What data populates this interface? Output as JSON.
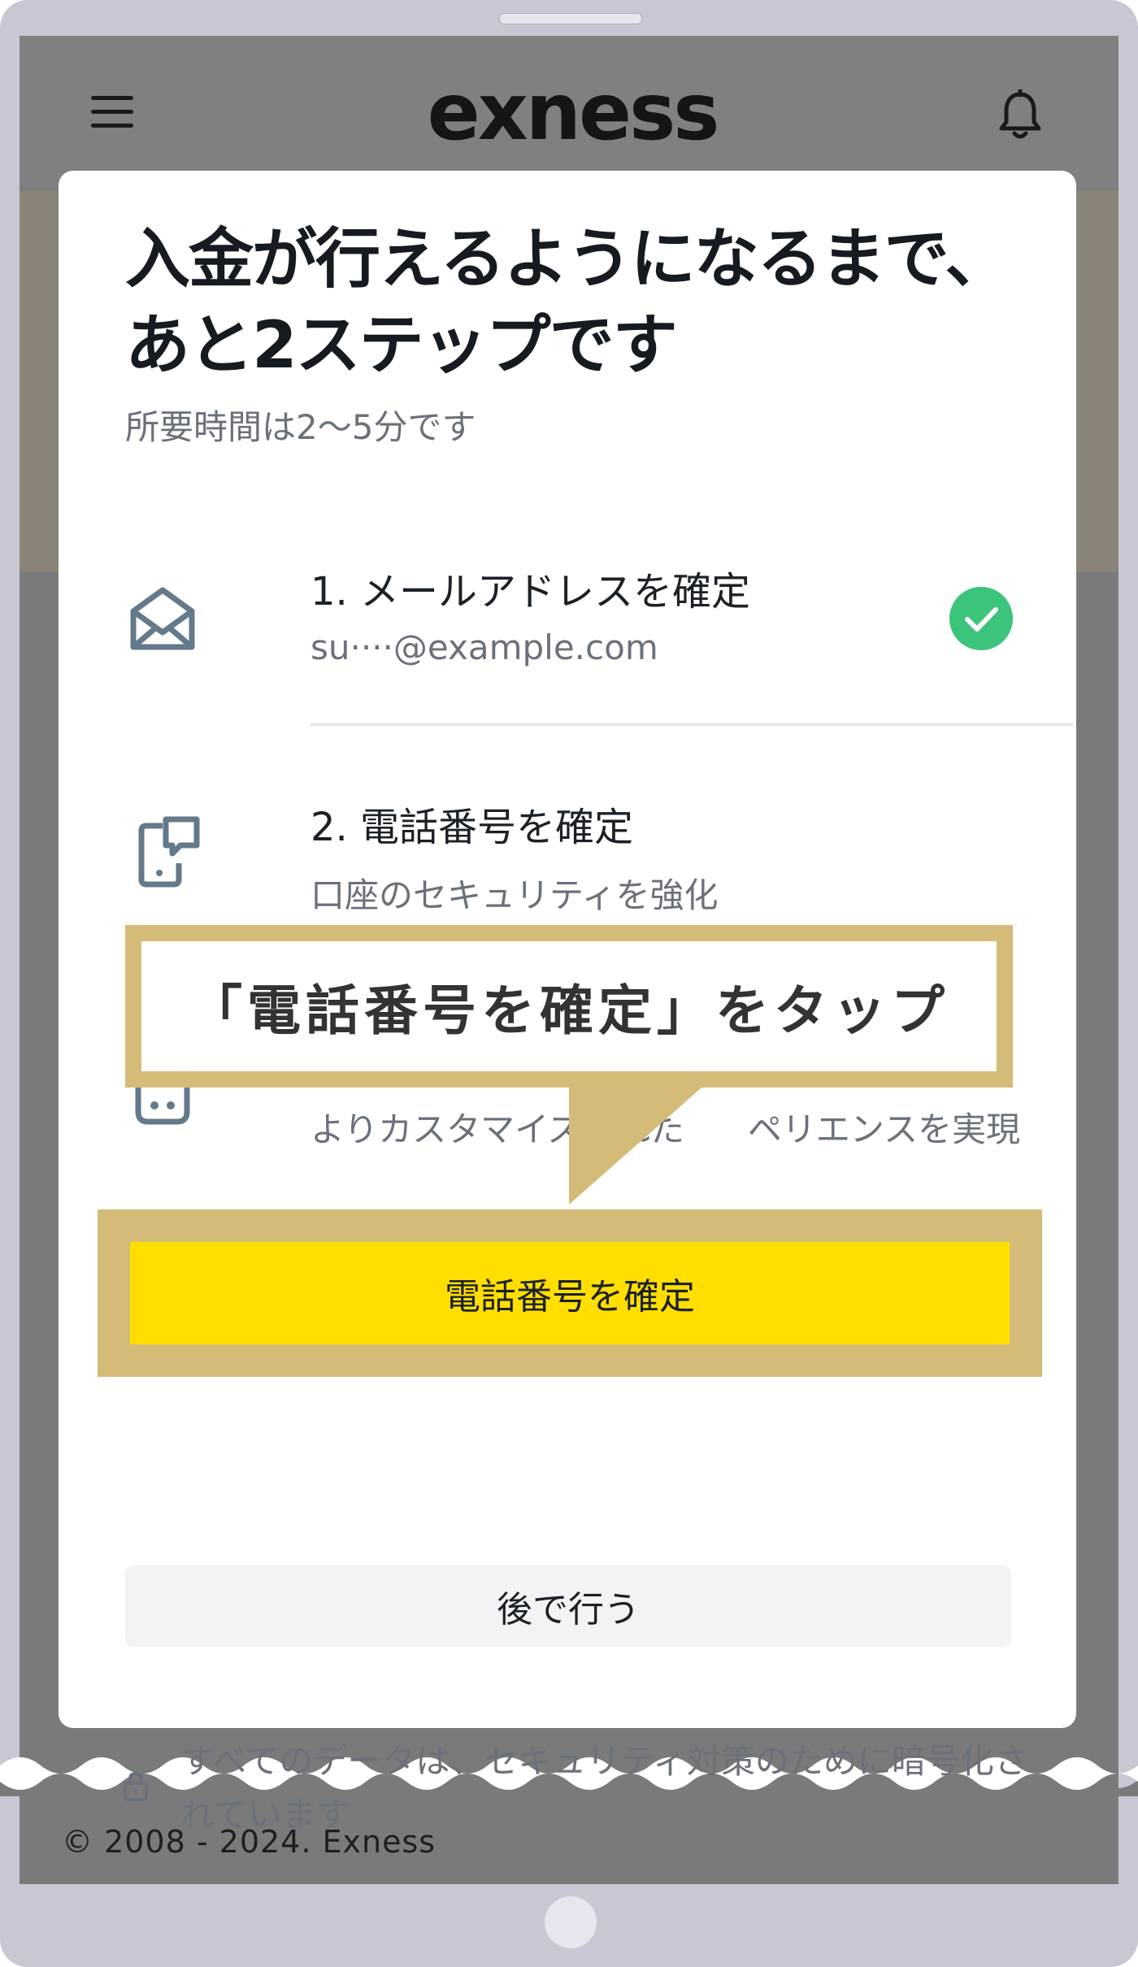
{
  "header": {
    "logo_text": "exness",
    "menu_icon": "menu-icon",
    "notification_icon": "bell-icon"
  },
  "modal": {
    "title": "入金が行えるようになるまで、あと2ステップです",
    "subtitle": "所要時間は2〜5分です",
    "steps": [
      {
        "title": "1. メールアドレスを確定",
        "description": "su····@example.com",
        "icon": "envelope-icon",
        "status": "completed"
      },
      {
        "title": "2. 電話番号を確定",
        "description": "口座のセキュリティを強化",
        "icon": "phone-verify-icon"
      },
      {
        "title": "",
        "description": "よりカスタマイズされた",
        "description_tail": "ペリエンスを実現",
        "icon": "profile-icon"
      }
    ],
    "primary_button": "電話番号を確定",
    "secondary_button": "後で行う",
    "security_note": "すべてのデータは、セキュリティ対策のために暗号化されています"
  },
  "annotation": {
    "callout_text": "「電話番号を確定」をタップ"
  },
  "footer": {
    "copyright": "© 2008 - 2024. Exness"
  },
  "colors": {
    "accent_yellow": "#ffde00",
    "annotation_gold": "#d4bc78",
    "success_green": "#3cc47c"
  }
}
